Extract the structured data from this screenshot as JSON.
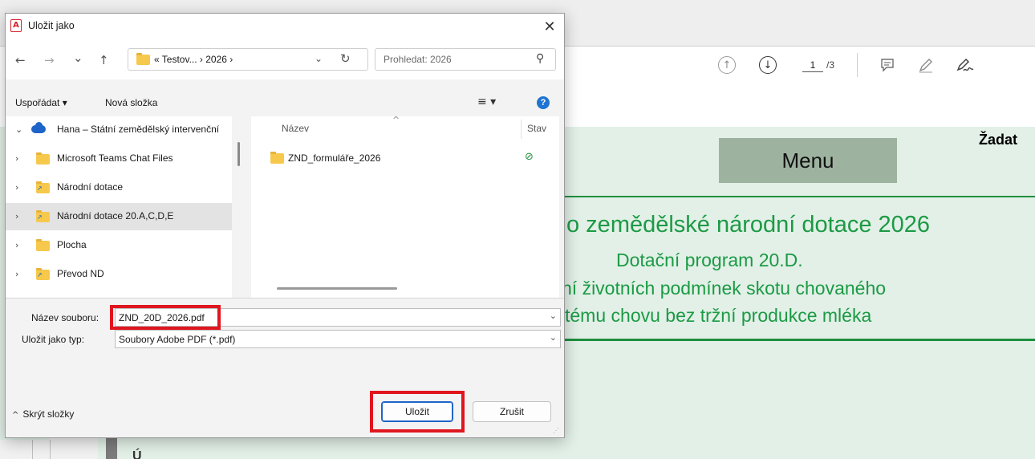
{
  "viewer": {
    "page_current": "1",
    "page_total": "/3",
    "menu_label": "Menu",
    "header_right": "Žadat",
    "pdf_lines": [
      "o zemědělské národní dotace 2026",
      "Dotační program 20.D.",
      "ní životních podmínek skotu chovaného",
      "tému chovu bez tržní produkce mléka"
    ],
    "pdf_cut_text": "Ú"
  },
  "dialog": {
    "title": "Uložit jako",
    "close": "✕",
    "nav": {
      "back": "←",
      "forward": "→",
      "recent": "⌄",
      "up": "↑"
    },
    "address": {
      "path": "« Testov... › 2026 ›",
      "chevron": "⌄",
      "refresh": "↻"
    },
    "search": {
      "placeholder": "Prohledat: 2026",
      "icon": "⚲"
    },
    "commands": {
      "organize": "Uspořádat ▾",
      "new_folder": "Nová složka",
      "view": "≡ ▾",
      "help": "?"
    },
    "tree": [
      {
        "chevron": "⌄",
        "label": "Hana – Státní zemědělský intervenční",
        "icon": "cloud-icon",
        "selected": false
      },
      {
        "chevron": "›",
        "label": "Microsoft Teams Chat Files",
        "icon": "folder-icon",
        "selected": false
      },
      {
        "chevron": "›",
        "label": "Národní dotace",
        "icon": "network-folder-icon",
        "selected": false
      },
      {
        "chevron": "›",
        "label": "Národní dotace 20.A,C,D,E",
        "icon": "network-folder-icon",
        "selected": true
      },
      {
        "chevron": "›",
        "label": "Plocha",
        "icon": "folder-icon",
        "selected": false
      },
      {
        "chevron": "›",
        "label": "Převod ND",
        "icon": "network-folder-icon",
        "selected": false
      }
    ],
    "columns": {
      "name": "Název",
      "sort": "^",
      "status": "Stav"
    },
    "files": [
      {
        "name": "ZND_formuláře_2026",
        "status": "⊘"
      }
    ],
    "file_name_label": "Název souboru:",
    "file_name_value": "ZND_20D_2026.pdf",
    "file_type_label": "Uložit jako typ:",
    "file_type_value": "Soubory Adobe PDF (*.pdf)",
    "dropdown": "⌄",
    "hide_folders": "Skrýt složky",
    "hide_caret": "^",
    "save": "Uložit",
    "cancel": "Zrušit"
  },
  "colors": {
    "highlight_red": "#e0161f",
    "pdf_green": "#1c9a45",
    "page_green": "#e2f0e7",
    "menu_box": "#9db3a0",
    "accent_blue": "#1f64c8"
  }
}
